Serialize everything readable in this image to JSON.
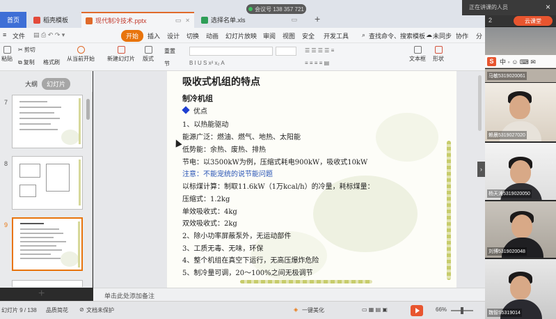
{
  "window": {
    "meeting_id": "会议号 138 357 721",
    "tabs": [
      {
        "label": "首页"
      },
      {
        "label": "稻壳模板"
      },
      {
        "label": "现代制冷技术.pptx"
      },
      {
        "label": "选择名单.xls"
      }
    ]
  },
  "menu": {
    "file": "文件",
    "items": [
      "开始",
      "插入",
      "设计",
      "切换",
      "动画",
      "幻灯片放映",
      "审阅",
      "视图",
      "安全",
      "开发工具"
    ],
    "search": "查找命令、搜索模板",
    "share": "未同步",
    "collab": "协作",
    "more": "分"
  },
  "toolbar": {
    "paste": "粘贴",
    "cut": "剪切",
    "copy": "复制",
    "format_painter": "格式刷",
    "play_from_current": "从当前开始",
    "new_slide": "新建幻灯片",
    "layout": "版式",
    "reset": "重置",
    "section": "节",
    "textbox": "文本框",
    "shape": "形状"
  },
  "left_panel": {
    "tab_outline": "大纲",
    "tab_slides": "幻灯片",
    "slide_numbers": [
      "7",
      "8",
      "9"
    ],
    "selected": "9"
  },
  "slide": {
    "title": "吸收式机组的特点",
    "subtitle": "制冷机组",
    "bullet": "优点",
    "lines": [
      "1、以热能驱动",
      "能源广泛：燃油、燃气、地热、太阳能",
      "低势能：余热、废热、排热",
      "节电：以3500kW为例，压缩式耗电900kW，吸收式10kW",
      "注意：不能宠统的说节能问题",
      "以标煤计算：制取11.6kW（1万kcal/h）的冷量，耗标煤量：",
      "压缩式：1.2kg",
      "单效吸收式：4kg",
      "双效吸收式：2kg",
      "2、除小功率屏蔽泵外，无运动部件",
      "3、工质无毒、无味，环保",
      "4、整个机组在真空下运行，无高压爆炸危险",
      "5、制冷量可调，20～100%之间无极调节"
    ],
    "note_line_index": 4
  },
  "notes": {
    "placeholder": "单击此处添加备注"
  },
  "status": {
    "slide_count": "幻灯片 9 / 138",
    "theme": "品质简花",
    "doc_state": "文档未保护",
    "beautify": "一键美化",
    "zoom": "66%"
  },
  "meeting_panel": {
    "top_text": "正在讲课的人员",
    "close": "×",
    "live_badge": "云课堂",
    "window_num": "2",
    "participants": [
      {
        "label": "马敏5319020061"
      },
      {
        "label": "赖晨5319027020"
      },
      {
        "label": "杨天涛5319020050"
      },
      {
        "label": "刘博5319020048"
      },
      {
        "label": "魏智S5319014"
      }
    ]
  },
  "colors": {
    "accent_orange": "#e8740c",
    "home_blue": "#3e6fd6",
    "note_blue": "#2b56b6",
    "bullet_blue": "#1f3fd1"
  }
}
